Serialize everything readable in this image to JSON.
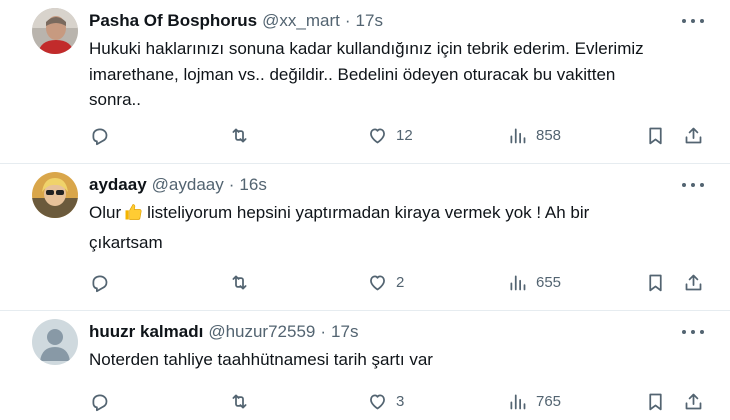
{
  "tweets": [
    {
      "name": "Pasha Of Bosphorus",
      "handle": "@xx_mart",
      "dot": "·",
      "time": "17s",
      "text_lines": [
        "Hukuki haklarınızı sonuna kadar kullandığınız için tebrik ederim. Evlerimiz",
        "imarethane, lojman vs.. değildir.. Bedelini ödeyen oturacak bu vakitten",
        "sonra.."
      ],
      "likes": "12",
      "views": "858",
      "avatar_icon": "user-photo-avatar"
    },
    {
      "name": "aydaay",
      "handle": "@aydaay",
      "dot": "·",
      "time": "16s",
      "text_before_emoji": "Olur",
      "text_after_emoji": "listeliyorum hepsini yaptırmadan kiraya vermek yok ! Ah bir",
      "text_line2": "çıkartsam",
      "emoji_icon": "thumbs-up-emoji",
      "likes": "2",
      "views": "655",
      "avatar_icon": "user-photo-avatar"
    },
    {
      "name": "huuzr kalmadı",
      "handle": "@huzur72559",
      "dot": "·",
      "time": "17s",
      "text_lines": [
        "Noterden tahliye taahhütnamesi tarih şartı var"
      ],
      "likes": "3",
      "views": "765",
      "avatar_icon": "default-avatar"
    }
  ],
  "colors": {
    "text": "#0f1419",
    "secondary": "#536471",
    "divider": "#e6ecf0",
    "default_avatar_bg": "#cfd9de"
  },
  "icons": [
    "reply-icon",
    "retweet-icon",
    "like-icon",
    "views-icon",
    "bookmark-icon",
    "share-icon",
    "more-icon"
  ]
}
